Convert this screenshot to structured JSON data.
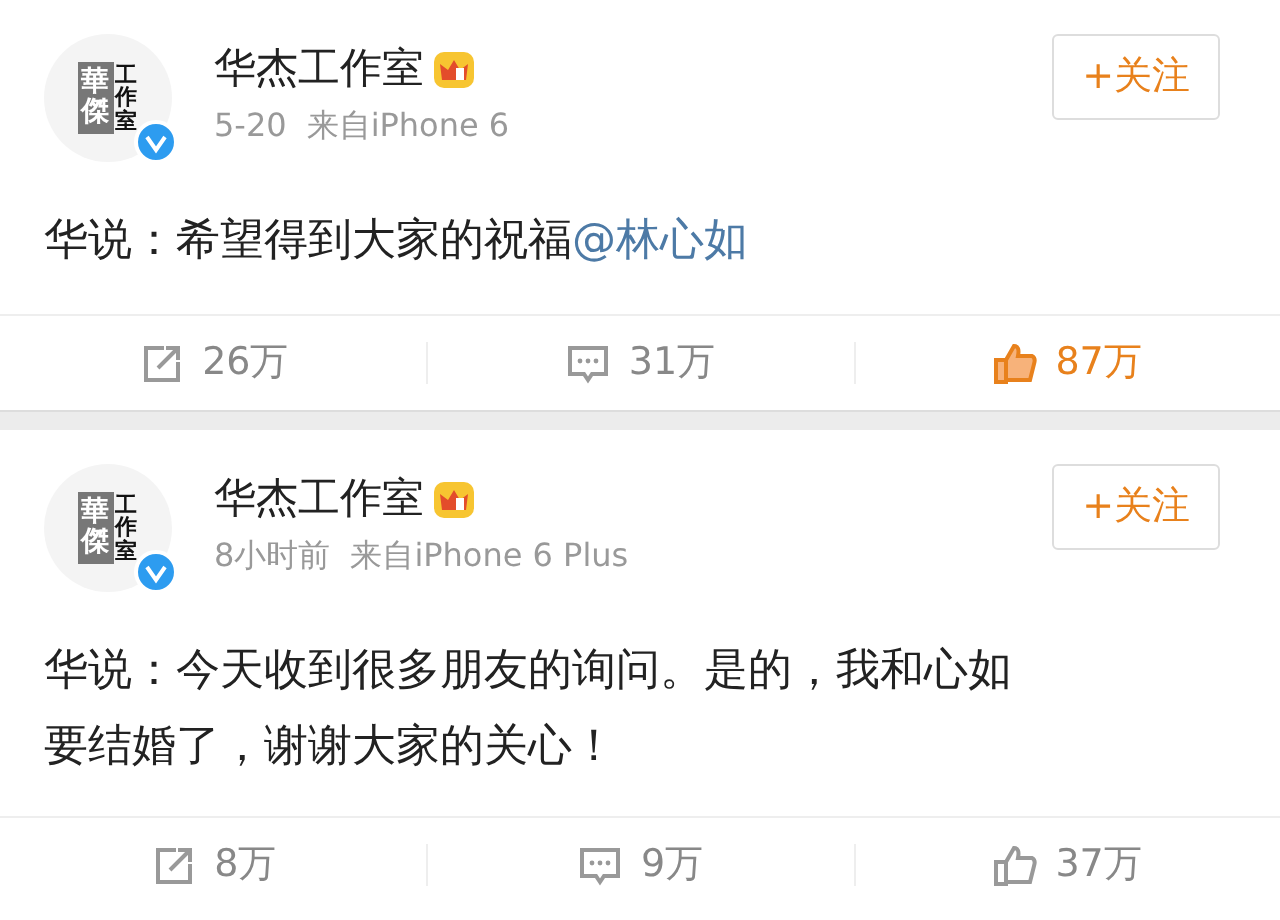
{
  "posts": [
    {
      "author": "华杰工作室",
      "avatar": {
        "block_text": "華傑",
        "side_text": "工作室"
      },
      "verified": true,
      "time": "5-20",
      "source": "来自iPhone 6",
      "follow_label": "+关注",
      "body": [
        "华说：希望得到大家的祝福"
      ],
      "mention": "@林心如",
      "actions": {
        "reposts": "26万",
        "comments": "31万",
        "likes": "87万",
        "liked": true
      }
    },
    {
      "author": "华杰工作室",
      "avatar": {
        "block_text": "華傑",
        "side_text": "工作室"
      },
      "verified": true,
      "time": "8小时前",
      "source": "来自iPhone 6 Plus",
      "follow_label": "+关注",
      "body": [
        "华说：今天收到很多朋友的询问。是的，我和心如",
        "要结婚了，谢谢大家的关心！"
      ],
      "actions": {
        "reposts": "8万",
        "comments": "9万",
        "likes": "37万",
        "liked": false
      }
    }
  ]
}
